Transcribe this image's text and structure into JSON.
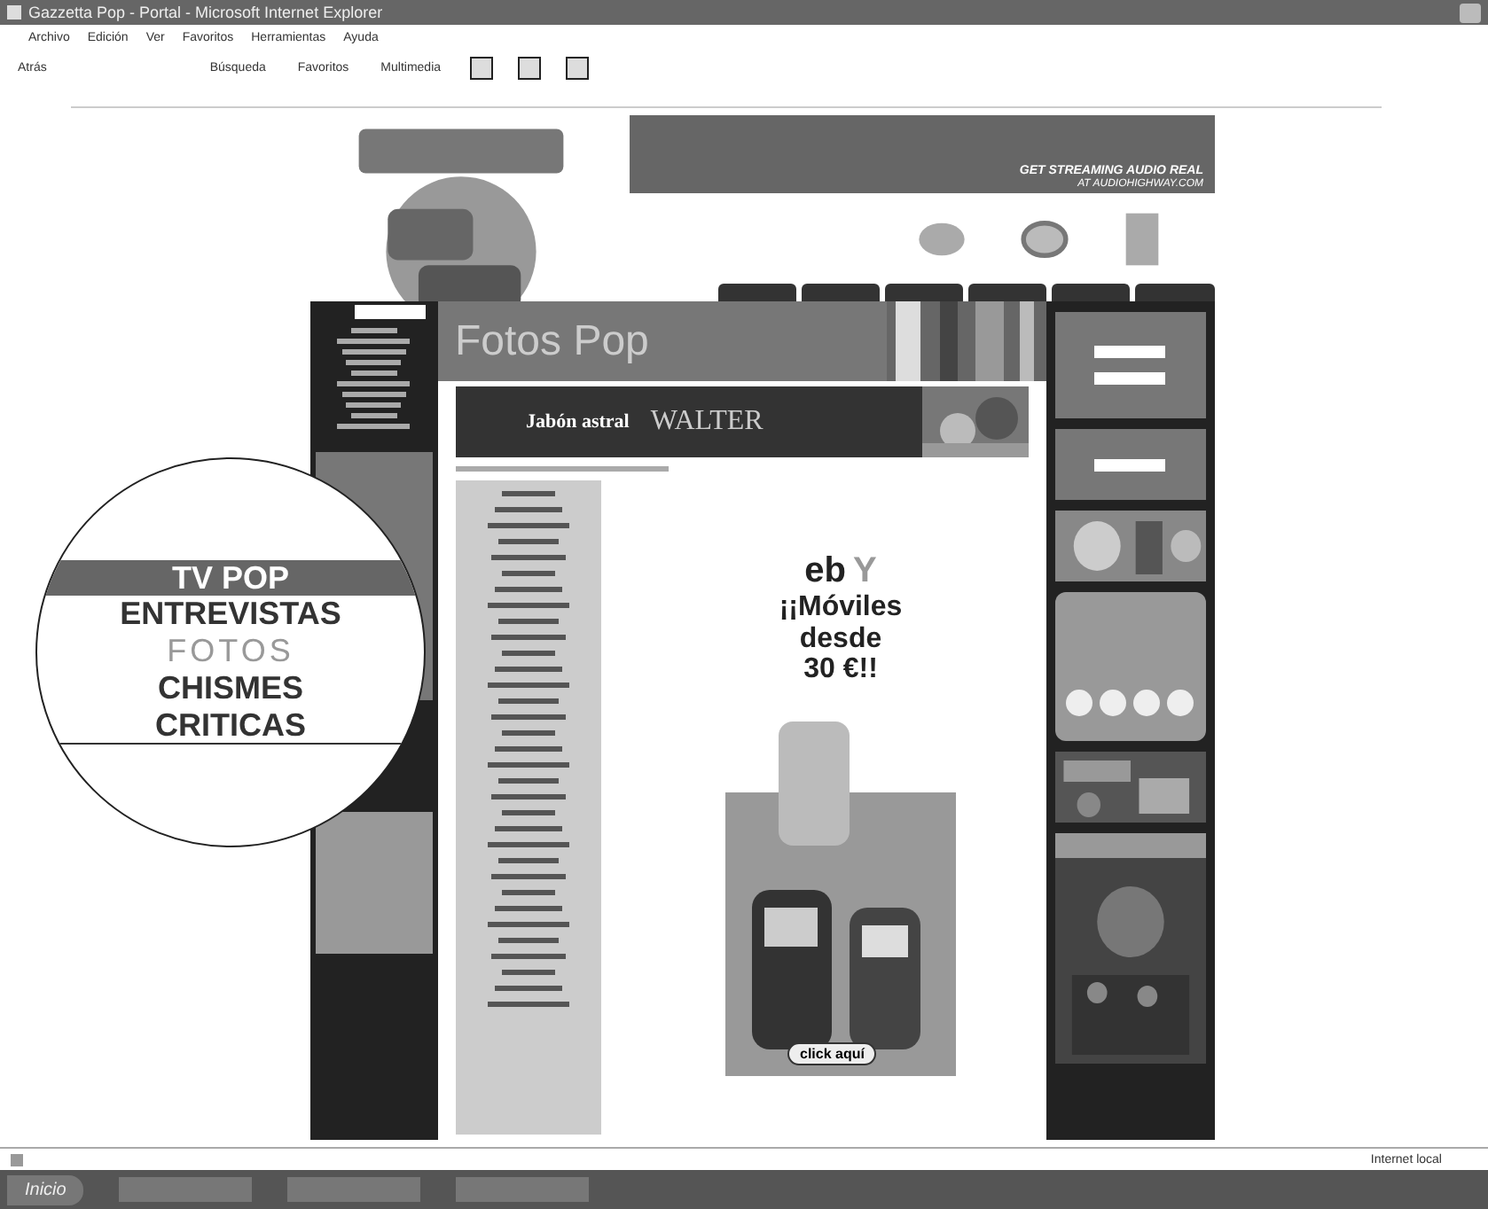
{
  "window": {
    "title": "Gazzetta Pop - Portal - Microsoft Internet Explorer"
  },
  "menu": [
    "Archivo",
    "Edición",
    "Ver",
    "Favoritos",
    "Herramientas",
    "Ayuda"
  ],
  "toolbar": [
    {
      "label": "Atrás"
    },
    {
      "label": "Búsqueda"
    },
    {
      "label": "Favoritos"
    },
    {
      "label": "Multimedia"
    }
  ],
  "banner": {
    "line_1": "GET STREAMING AUDIO REAL",
    "line_2": "AT AUDIOHIGHWAY.COM"
  },
  "page_heading": "Fotos Pop",
  "ad_banner": {
    "product": "Jabón astral",
    "brand": "WALTER"
  },
  "phone_ad": {
    "logo_left": "eb",
    "logo_right": "Y",
    "headline": [
      "¡¡Móviles",
      "desde",
      "30 €!!"
    ],
    "button": "click aquí"
  },
  "magnifier": {
    "items": [
      {
        "label": "TV POP",
        "kind": "highlight"
      },
      {
        "label": "ENTREVISTAS",
        "kind": "link"
      },
      {
        "label": "FOTOS",
        "kind": "current"
      },
      {
        "label": "CHISMES",
        "kind": "link"
      },
      {
        "label": "CRITICAS",
        "kind": "link"
      }
    ]
  },
  "status_bar": {
    "zone": "Internet local"
  },
  "taskbar": {
    "start": "Inicio"
  }
}
